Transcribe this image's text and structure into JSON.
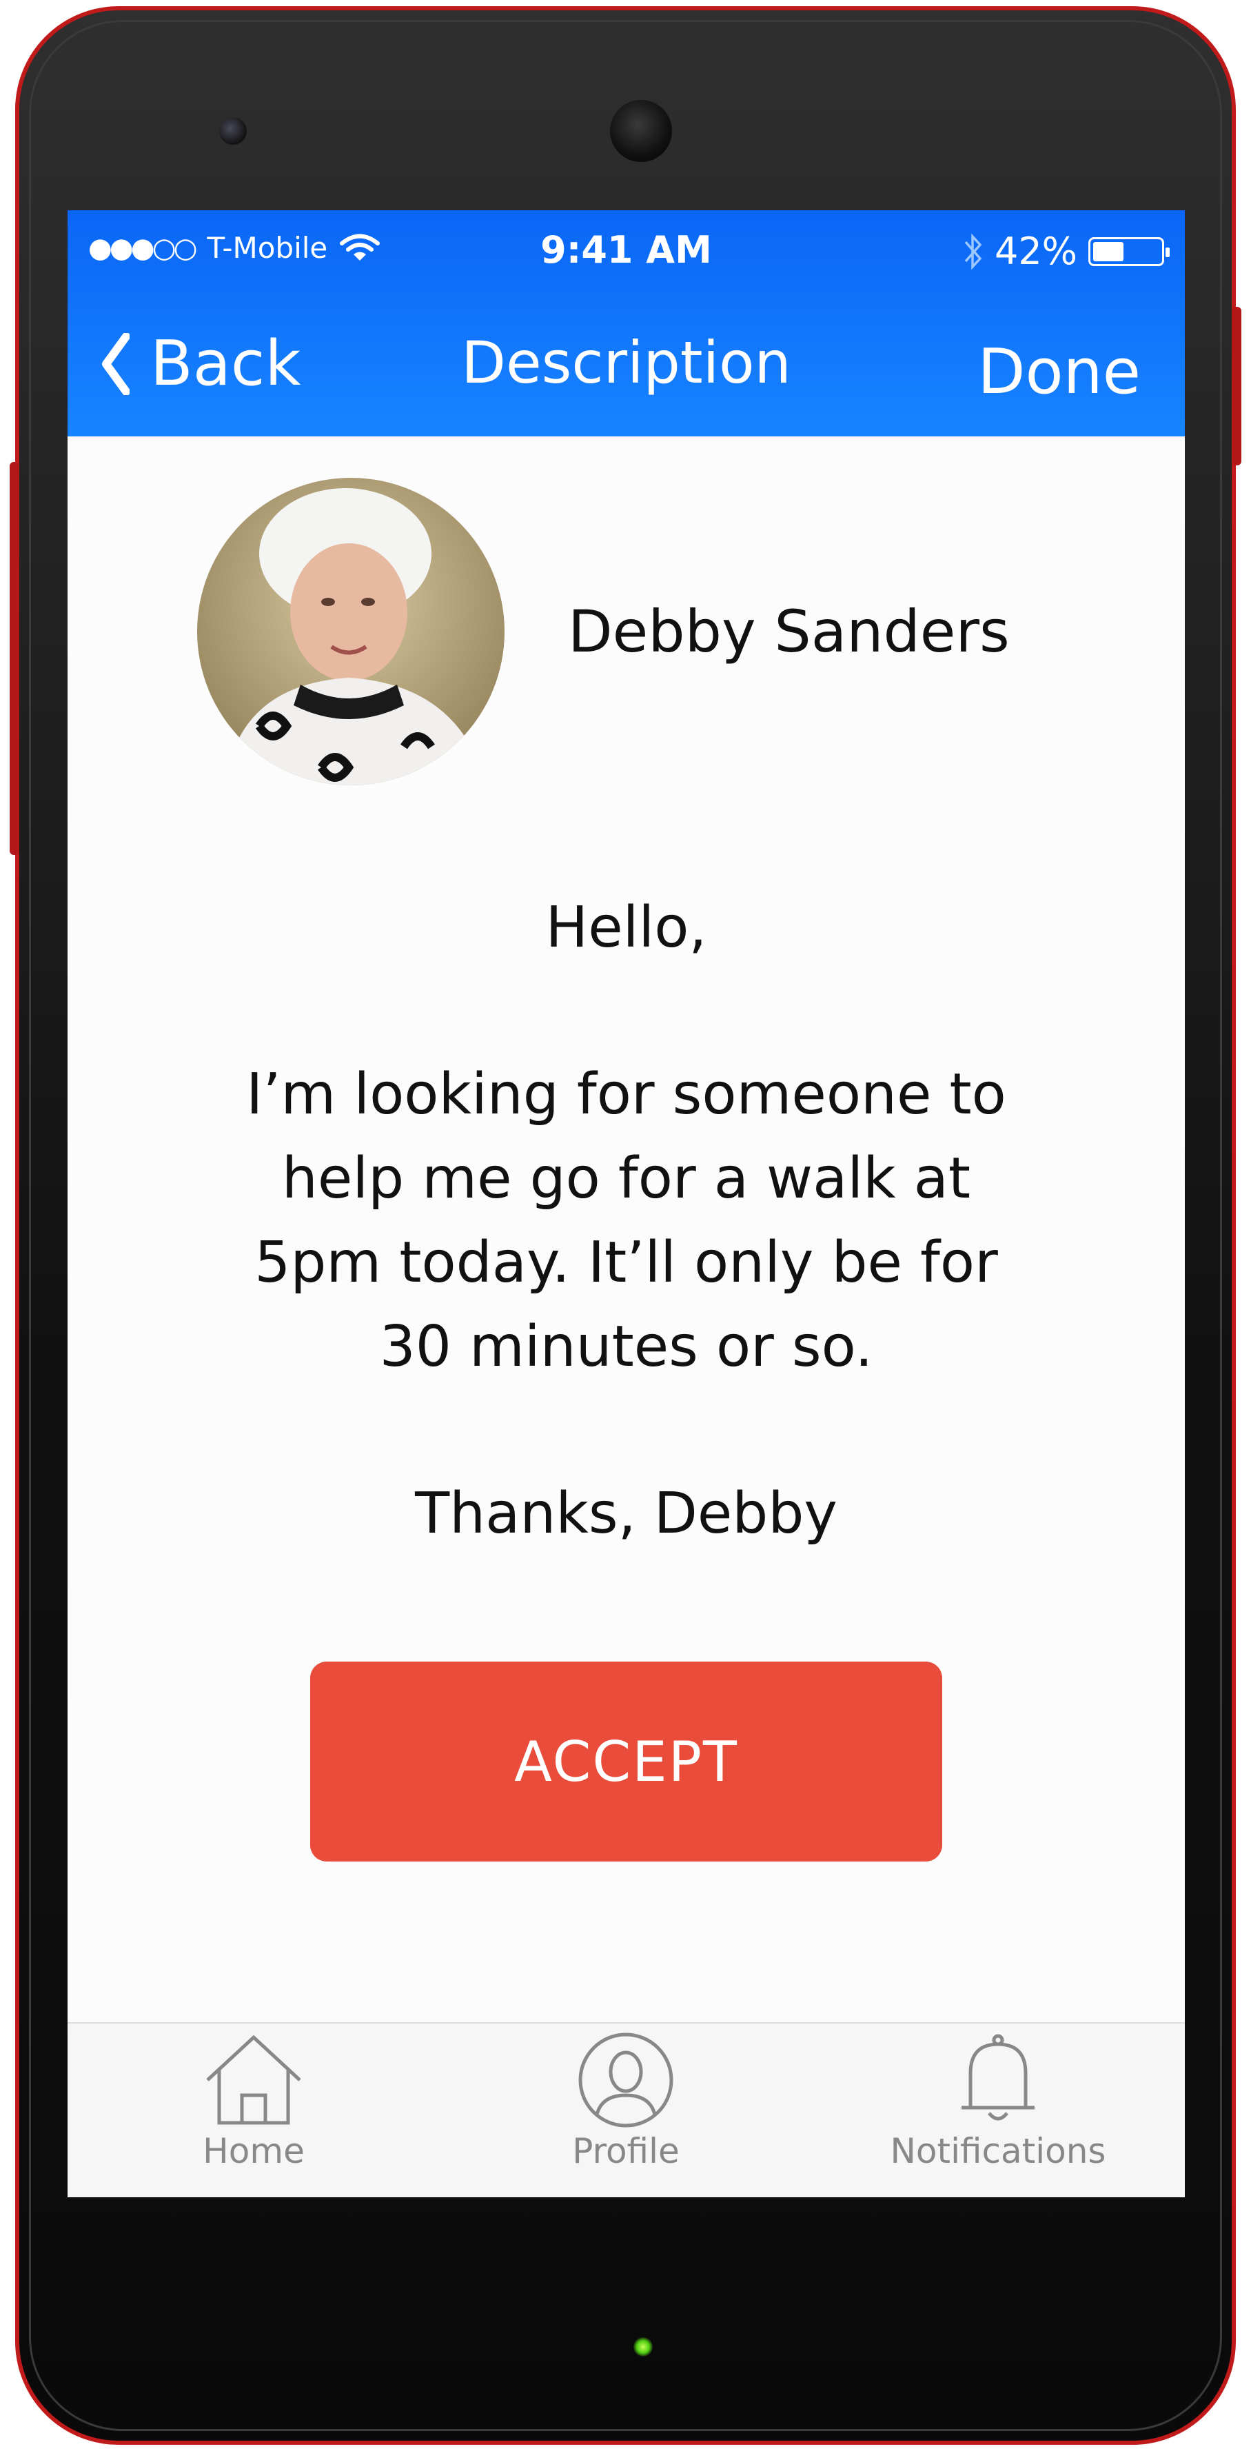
{
  "status_bar": {
    "signal": "●●●○○",
    "carrier": "T-Mobile",
    "time": "9:41 AM",
    "battery_percent": "42%",
    "battery_level": 0.42,
    "icons": [
      "wifi-icon",
      "bluetooth-icon",
      "battery-icon"
    ]
  },
  "nav": {
    "back_label": "Back",
    "title": "Description",
    "done_label": "Done"
  },
  "profile": {
    "name": "Debby Sanders"
  },
  "message": {
    "greeting": "Hello,",
    "lines": [
      "I’m looking for someone to",
      "help me go for a walk at",
      "5pm today. It’ll only be for",
      "30 minutes or so."
    ],
    "signoff": "Thanks, Debby"
  },
  "accept_label": "ACCEPT",
  "tabs": [
    {
      "label": "Home",
      "icon": "home-icon"
    },
    {
      "label": "Profile",
      "icon": "profile-icon"
    },
    {
      "label": "Notifications",
      "icon": "bell-icon"
    }
  ],
  "colors": {
    "accent_blue": "#1784ff",
    "accept_red": "#ea4c3b",
    "phone_border": "#c11a1a"
  }
}
